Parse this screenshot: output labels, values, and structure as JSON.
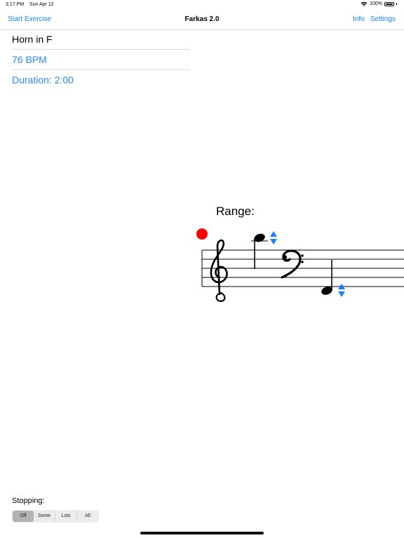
{
  "status": {
    "time": "3:17 PM",
    "date": "Sun Apr 12",
    "battery": "100%",
    "battery_level": 1.0
  },
  "nav": {
    "left": "Start Exercise",
    "title": "Farkas 2.0",
    "info": "Info",
    "settings": "Settings"
  },
  "list": {
    "instrument": "Horn in F",
    "tempo": "76 BPM",
    "duration": "Duration: 2:00"
  },
  "range": {
    "label": "Range:",
    "record_color": "#ff0000",
    "arrow_color": "#1a7ef5"
  },
  "stopping": {
    "label": "Stopping:",
    "options": [
      "Off",
      "Some",
      "Lots",
      "All"
    ],
    "selected": "Off"
  },
  "colors": {
    "accent": "#1a7ef5"
  }
}
